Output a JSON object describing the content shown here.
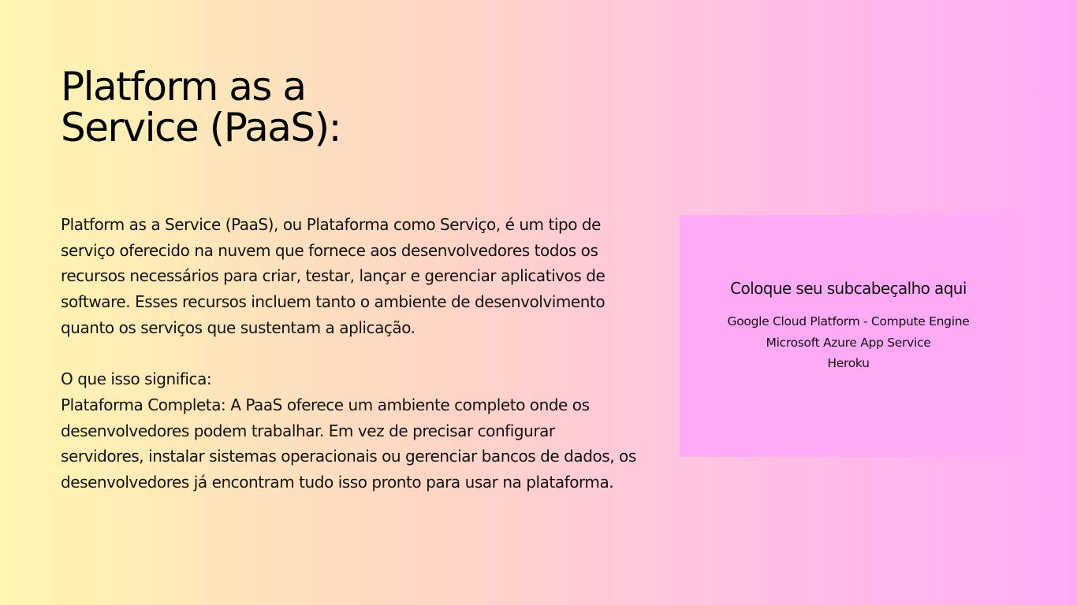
{
  "slide": {
    "title_lines": [
      "Platform as a",
      "Service (PaaS):"
    ],
    "body": {
      "intro": "Platform as a Service (PaaS), ou Plataforma como Serviço, é um tipo de serviço oferecido na nuvem que fornece aos desenvolvedores todos os recursos necessários para criar, testar, lançar e gerenciar aplicativos de software. Esses recursos incluem tanto o ambiente de desenvolvimento quanto os serviços que sustentam a aplicação.",
      "question": "O que isso significa:",
      "detail": "Plataforma Completa: A PaaS oferece um ambiente completo onde os desenvolvedores podem trabalhar. Em vez de precisar configurar servidores, instalar sistemas operacionais ou gerenciar bancos de dados, os desenvolvedores já encontram tudo isso pronto para usar na plataforma."
    },
    "card": {
      "heading": "Coloque seu subcabeçalho aqui",
      "items": [
        "Google Cloud Platform - Compute Engine",
        "Microsoft Azure App Service",
        "Heroku"
      ]
    }
  },
  "colors": {
    "gradient_left": "#fff6b0",
    "gradient_right": "#ffaaf6",
    "card_background": "#ffaaf6",
    "text": "#111111"
  }
}
